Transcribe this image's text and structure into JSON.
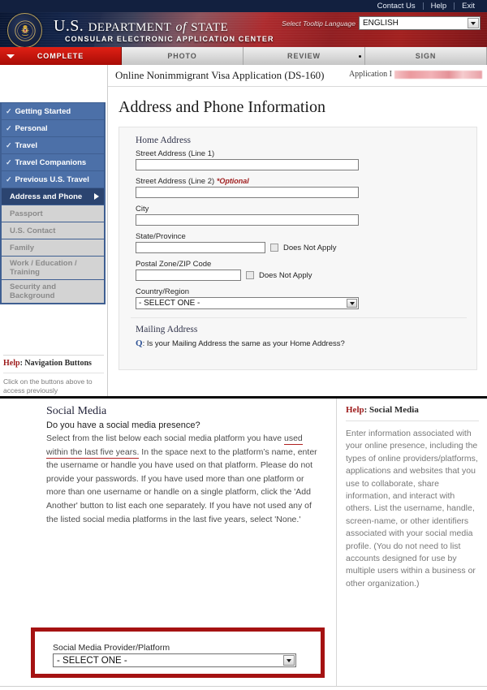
{
  "utility_nav": {
    "links": [
      {
        "label": "Contact Us"
      },
      {
        "label": "Help"
      },
      {
        "label": "Exit"
      }
    ]
  },
  "banner": {
    "title_us": "U.S.",
    "title_department": "DEPARTMENT",
    "title_of": "of",
    "title_state": "STATE",
    "subtitle": "CONSULAR ELECTRONIC APPLICATION CENTER",
    "seal_icon": "great-seal-eagle-icon",
    "language": {
      "label": "Select Tooltip Language",
      "value": "ENGLISH",
      "caret_icon": "chevron-down-icon"
    }
  },
  "steps": [
    {
      "label": "COMPLETE",
      "active": true
    },
    {
      "label": "PHOTO",
      "active": false
    },
    {
      "label": "REVIEW",
      "active": false
    },
    {
      "label": "SIGN",
      "active": false
    }
  ],
  "sidebar": {
    "items": [
      {
        "label": "Getting Started",
        "state": "complete"
      },
      {
        "label": "Personal",
        "state": "complete"
      },
      {
        "label": "Travel",
        "state": "complete"
      },
      {
        "label": "Travel Companions",
        "state": "complete"
      },
      {
        "label": "Previous U.S. Travel",
        "state": "complete"
      },
      {
        "label": "Address and Phone",
        "state": "current"
      },
      {
        "label": "Passport",
        "state": "disabled"
      },
      {
        "label": "U.S. Contact",
        "state": "disabled"
      },
      {
        "label": "Family",
        "state": "disabled"
      },
      {
        "label": "Work / Education /",
        "label2": "Training",
        "state": "disabled"
      },
      {
        "label": "Security and",
        "label2": "Background",
        "state": "disabled"
      }
    ],
    "check_icon": "check-icon",
    "arrow_icon": "arrow-right-icon",
    "help": {
      "title_prefix": "Help",
      "title_suffix": ": Navigation Buttons",
      "body": "Click on the buttons above to access previously"
    }
  },
  "app_bar": {
    "title": "Online Nonimmigrant Visa Application (DS-160)",
    "application_id_label": "Application I",
    "application_id_value": ""
  },
  "page": {
    "heading": "Address and Phone Information"
  },
  "home_address": {
    "section_title": "Home Address",
    "street1_label": "Street Address (Line 1)",
    "street1_value": "",
    "street2_label": "Street Address (Line 2)",
    "street2_optional": "*Optional",
    "street2_value": "",
    "city_label": "City",
    "city_value": "",
    "state_label": "State/Province",
    "state_value": "",
    "state_does_not_apply": "Does Not Apply",
    "postal_label": "Postal Zone/ZIP Code",
    "postal_value": "",
    "postal_does_not_apply": "Does Not Apply",
    "country_label": "Country/Region",
    "country_value": "- SELECT ONE -",
    "caret_icon": "chevron-down-icon"
  },
  "mailing_address": {
    "section_title": "Mailing Address",
    "q_marker": "Q",
    "question": ": Is your Mailing Address the same as your Home Address?"
  },
  "social_media": {
    "title": "Social Media",
    "question": "Do you have a social media presence?",
    "instructions_part1": "Select from the list below each social media platform you have ",
    "instructions_underlined": "used within the last five years.",
    "instructions_part2": " In the space next to the platform’s name, enter the username or handle you have used on that platform. Please do not provide your passwords. If you have used more than one platform or more than one username or handle on a single platform, click the 'Add Another' button to list each one separately. If you have not used any of the listed social media platforms in the last five years, select 'None.'",
    "help": {
      "title_prefix": "Help",
      "title_suffix": ": Social Media",
      "body": "Enter information associated with your online presence, including the types of online providers/platforms, applications and websites that you use to collaborate, share information, and interact with others. List the username, handle, screen-name, or other identifiers associated with your social media profile. (You do not need to list accounts designed for use by multiple users within a business or other organization.)"
    },
    "provider": {
      "label": "Social Media Provider/Platform",
      "value": "- SELECT ONE -",
      "caret_icon": "chevron-down-icon"
    }
  },
  "colors": {
    "banner_navy": "#12203f",
    "banner_red": "#a81f22",
    "active_tab_red": "#c3120a",
    "nav_blue": "#4c70a8",
    "nav_current_blue": "#2b4470",
    "nav_disabled_gray": "#d3d3d3",
    "highlight_box_red": "#a51212",
    "help_red": "#9d1b1b",
    "optional_red": "#a02020"
  }
}
